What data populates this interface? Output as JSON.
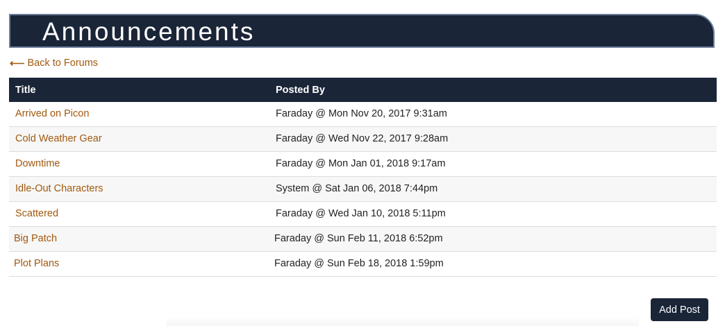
{
  "page": {
    "title": "Announcements",
    "back_arrow": "⟵",
    "back_label": "Back to Forums"
  },
  "table": {
    "headers": {
      "title": "Title",
      "posted_by": "Posted By"
    },
    "rows": [
      {
        "title": "Arrived on Picon",
        "posted_by": "Faraday @ Mon Nov 20, 2017 9:31am"
      },
      {
        "title": "Cold Weather Gear",
        "posted_by": "Faraday @ Wed Nov 22, 2017 9:28am"
      },
      {
        "title": "Downtime",
        "posted_by": "Faraday @ Mon Jan 01, 2018 9:17am"
      },
      {
        "title": "Idle-Out Characters",
        "posted_by": "System @ Sat Jan 06, 2018 7:44pm"
      },
      {
        "title": "Scattered",
        "posted_by": "Faraday @ Wed Jan 10, 2018 5:11pm"
      },
      {
        "title": "Big Patch",
        "posted_by": "Faraday @ Sun Feb 11, 2018 6:52pm"
      },
      {
        "title": "Plot Plans",
        "posted_by": "Faraday @ Sun Feb 18, 2018 1:59pm"
      }
    ]
  },
  "actions": {
    "add_post_label": "Add Post"
  },
  "colors": {
    "banner": "#1b2538",
    "banner_border": "#6d7f9a",
    "link": "#a0580e",
    "row_alt": "#f7f7f7"
  }
}
